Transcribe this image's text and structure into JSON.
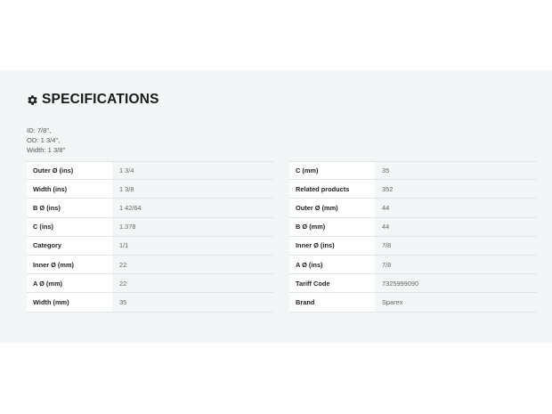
{
  "section": {
    "title": "SPECIFICATIONS",
    "icon": "gear-icon"
  },
  "description": {
    "lines": [
      "ID: 7/8\",",
      "OD: 1 3/4\",",
      "Width: 1 3/8\""
    ]
  },
  "specs_left": [
    {
      "label": "Outer Ø (ins)",
      "value": "1 3/4"
    },
    {
      "label": "Width (ins)",
      "value": "1 3/8"
    },
    {
      "label": "B Ø (ins)",
      "value": "1 42/64"
    },
    {
      "label": "C (ins)",
      "value": "1.378"
    },
    {
      "label": "Category",
      "value": "1/1"
    },
    {
      "label": "Inner Ø (mm)",
      "value": "22"
    },
    {
      "label": "A Ø (mm)",
      "value": "22"
    },
    {
      "label": "Width (mm)",
      "value": "35"
    }
  ],
  "specs_right": [
    {
      "label": "C (mm)",
      "value": "35"
    },
    {
      "label": "Related products",
      "value": "352"
    },
    {
      "label": "Outer Ø (mm)",
      "value": "44"
    },
    {
      "label": "B Ø (mm)",
      "value": "44"
    },
    {
      "label": "Inner Ø (ins)",
      "value": "7/8"
    },
    {
      "label": "A Ø (ins)",
      "value": "7/8"
    },
    {
      "label": "Tariff Code",
      "value": "7325999090"
    },
    {
      "label": "Brand",
      "value": "Sparex"
    }
  ]
}
